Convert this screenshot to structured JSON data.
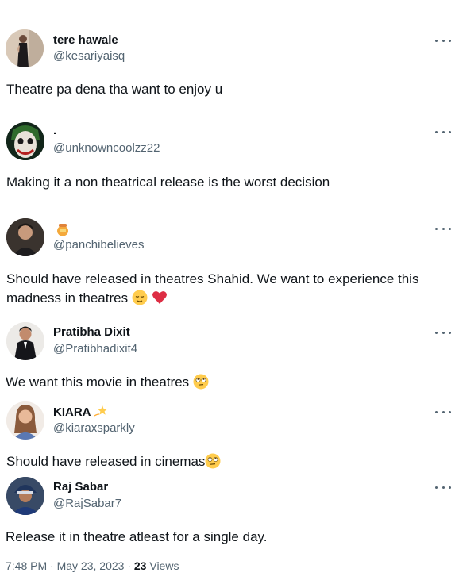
{
  "replies": [
    {
      "name": "tere hawale",
      "handle": "@kesariyaisq",
      "text": "Theatre pa dena tha want to enjoy u",
      "avatar": "woman-in-black-dress-avatar"
    },
    {
      "name": ".",
      "handle": "@unknowncoolzz22",
      "text": "Making it a non theatrical release is the worst decision",
      "avatar": "joker-avatar"
    },
    {
      "name": "",
      "handle": "@panchibelieves",
      "text_line1": "Should have released in theatres Shahid. We want to experience this",
      "text_line2": "madness in theatres",
      "avatar": "man-portrait-avatar",
      "name_emoji": "honey-pot-icon"
    },
    {
      "name": "Pratibha Dixit",
      "handle": "@Pratibhadixit4",
      "text": "We want this movie in theatres",
      "avatar": "man-in-suit-avatar"
    },
    {
      "name": "KIARA",
      "handle": "@kiaraxsparkly",
      "text": "Should have released in cinemas",
      "avatar": "woman-smiling-avatar",
      "name_emoji": "dizzy-star-icon"
    },
    {
      "name": "Raj Sabar",
      "handle": "@RajSabar7",
      "text": "Release it in theatre atleast for a single day.",
      "avatar": "man-with-helmet-avatar"
    }
  ],
  "footer": {
    "time": "7:48 PM",
    "separator": "·",
    "date": "May 23, 2023",
    "views_count": "23",
    "views_label": "Views"
  },
  "colors": {
    "text": "#0f1419",
    "muted": "#536471",
    "heart": "#dd2e44",
    "emoji_face": "#ffcc4d"
  }
}
